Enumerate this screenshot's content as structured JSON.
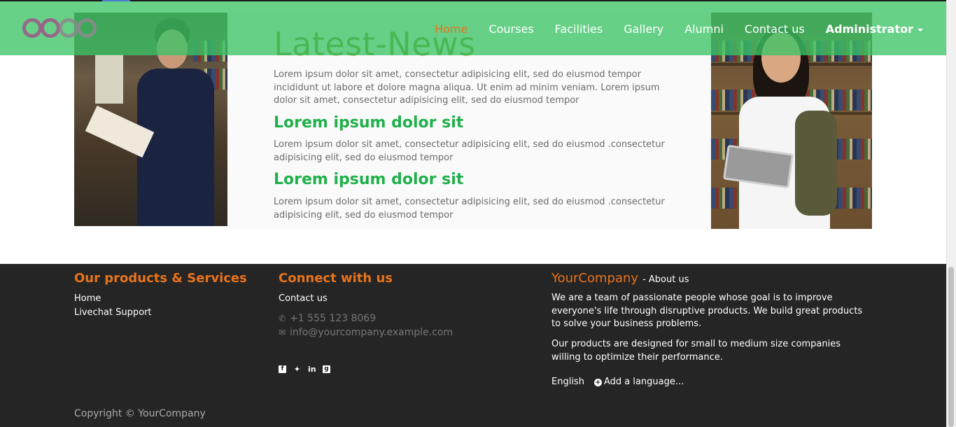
{
  "navbar": {
    "logo_text": "odoo",
    "items": [
      {
        "label": "Home",
        "active": true
      },
      {
        "label": "Courses"
      },
      {
        "label": "Facilities"
      },
      {
        "label": "Gallery"
      },
      {
        "label": "Alumni"
      },
      {
        "label": "Contact us"
      },
      {
        "label": "Administrator"
      }
    ],
    "accent_color": "#e8731c",
    "background_color": "#3cc465"
  },
  "news": {
    "title": "Latest-News",
    "intro": "Lorem ipsum dolor sit amet, consectetur adipisicing elit, sed do eiusmod tempor incididunt ut labore et dolore magna aliqua. Ut enim ad minim veniam. Lorem ipsum dolor sit amet, consectetur adipisicing elit, sed do eiusmod tempor",
    "sections": [
      {
        "heading": "Lorem ipsum dolor sit",
        "body": "Lorem ipsum dolor sit amet, consectetur adipisicing elit, sed do eiusmod .consectetur adipisicing elit, sed do eiusmod tempor"
      },
      {
        "heading": "Lorem ipsum dolor sit",
        "body": "Lorem ipsum dolor sit amet, consectetur adipisicing elit, sed do eiusmod .consectetur adipisicing elit, sed do eiusmod tempor"
      }
    ]
  },
  "footer": {
    "products": {
      "heading": "Our products & Services",
      "links": [
        "Home",
        "Livechat Support"
      ]
    },
    "connect": {
      "heading": "Connect with us",
      "contact_link": "Contact us",
      "phone": "+1 555 123 8069",
      "email": "info@yourcompany.example.com",
      "social_icons": [
        "facebook-icon",
        "twitter-icon",
        "linkedin-icon",
        "google-plus-icon"
      ]
    },
    "about": {
      "company": "YourCompany",
      "suffix": "- About us",
      "para1": "We are a team of passionate people whose goal is to improve everyone's life through disruptive products. We build great products to solve your business problems.",
      "para2": "Our products are designed for small to medium size companies willing to optimize their performance.",
      "language": "English",
      "add_language": "Add a language..."
    },
    "copyright": "Copyright © YourCompany"
  }
}
